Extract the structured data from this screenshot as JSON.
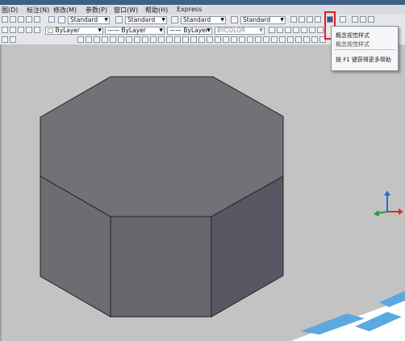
{
  "menu": {
    "items": [
      "图(D)",
      "标注(N)",
      "修改(M)",
      "参数(P)",
      "窗口(W)",
      "帮助(H)",
      "Express"
    ]
  },
  "styles_toolbar": {
    "text_style": "Standard",
    "dim_style": "Standard",
    "table_style": "Standard",
    "multileader_style": "Standard"
  },
  "properties_toolbar": {
    "layer": "ByLayer",
    "color": "ByLayer",
    "linetype": "ByLayer",
    "lineweight": "ByLayer",
    "plotstyle": "BYCOLOR"
  },
  "tooltip": {
    "title": "概念视觉样式",
    "subtitle": "概念视觉样式",
    "help": "按 F1 键获得更多帮助"
  },
  "colors": {
    "highlight": "#e02020",
    "top_face": "#727276",
    "left_face": "#6c6c71",
    "front_face": "#66666c",
    "right_face": "#585864",
    "background": "#c3c3c3"
  },
  "icons": {
    "ucs": "ucs-axis-icon",
    "visual_style": "visual-style-concept-icon"
  }
}
